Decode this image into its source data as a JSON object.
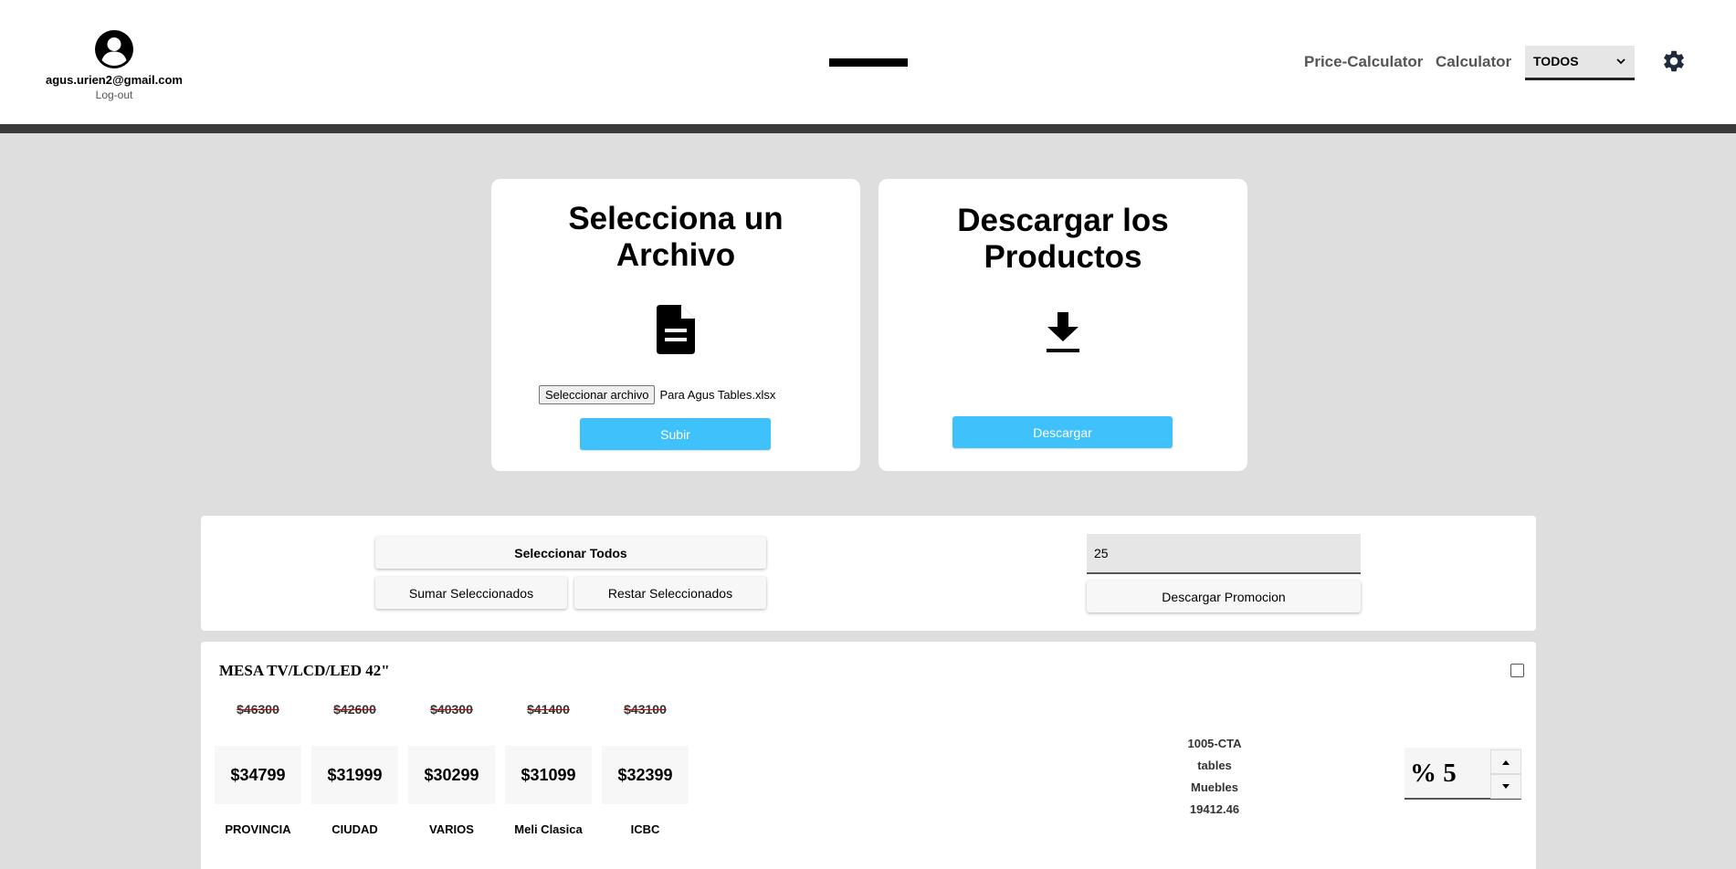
{
  "header": {
    "user_email": "agus.urien2@gmail.com",
    "logout_label": "Log-out",
    "nav": {
      "price_calculator": "Price-Calculator",
      "calculator": "Calculator"
    },
    "filter_select": {
      "selected": "TODOS"
    },
    "icons": {
      "avatar": "user-circle-icon",
      "settings": "gear-icon",
      "select_arrow": "chevron-down-icon"
    }
  },
  "upload_card": {
    "title": "Selecciona un Archivo",
    "icon": "file-document-icon",
    "file_button_label": "Seleccionar archivo",
    "file_name": "Para Agus Tables.xlsx",
    "submit_label": "Subir"
  },
  "download_card": {
    "title": "Descargar los Productos",
    "icon": "download-icon",
    "button_label": "Descargar"
  },
  "controls": {
    "select_all_label": "Seleccionar Todos",
    "add_selected_label": "Sumar Seleccionados",
    "subtract_selected_label": "Restar Seleccionados",
    "promo_value": "25",
    "download_promo_label": "Descargar Promocion"
  },
  "product": {
    "title": "MESA TV/LCD/LED 42\"",
    "prices": [
      {
        "list": "PROVINCIA",
        "old": "$46300",
        "new": "$34799"
      },
      {
        "list": "CIUDAD",
        "old": "$42600",
        "new": "$31999"
      },
      {
        "list": "VARIOS",
        "old": "$40300",
        "new": "$30299"
      },
      {
        "list": "Meli Clasica",
        "old": "$41400",
        "new": "$31099"
      },
      {
        "list": "ICBC",
        "old": "$43100",
        "new": "$32399"
      }
    ],
    "code": "1005-CTA",
    "line": "tables",
    "category": "Muebles",
    "cost": "19412.46",
    "percent_display": "% 5"
  },
  "colors": {
    "accent_blue": "#3fc1fb",
    "page_background": "#dedede",
    "header_bar": "#3a3a3a",
    "strike_red": "#cc0000"
  }
}
